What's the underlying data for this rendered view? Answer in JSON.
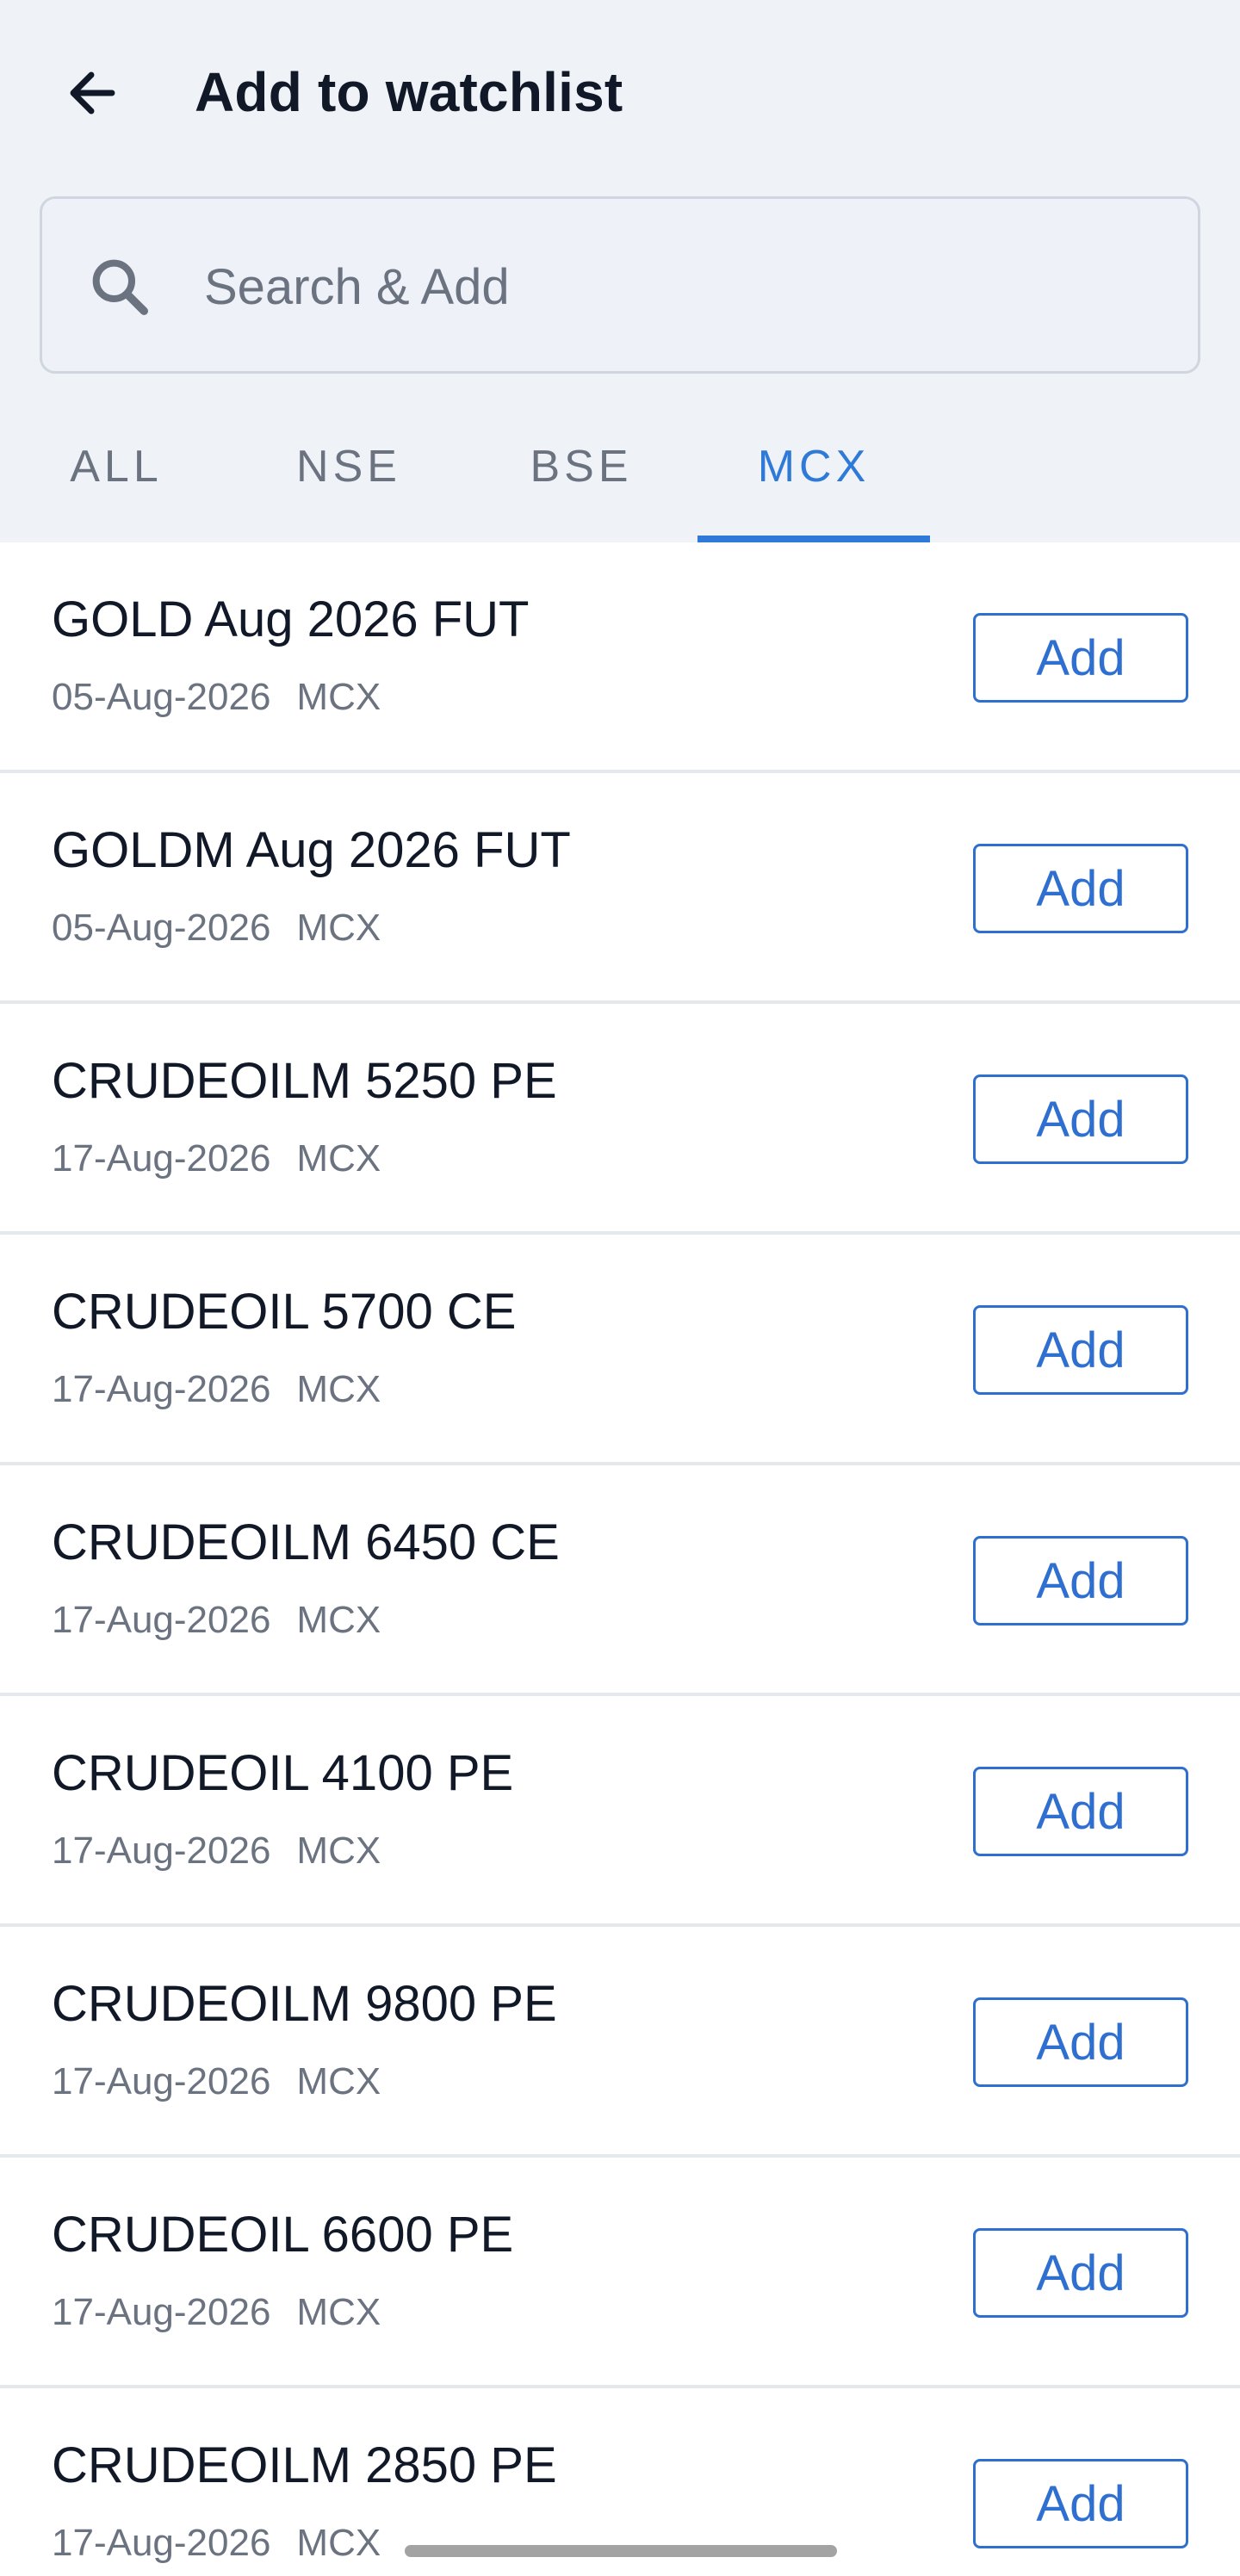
{
  "header": {
    "title": "Add to watchlist",
    "back_icon": "arrow-left-icon"
  },
  "search": {
    "placeholder": "Search & Add",
    "value": "",
    "icon": "search-icon"
  },
  "tabs": [
    {
      "label": "ALL",
      "active": false
    },
    {
      "label": "NSE",
      "active": false
    },
    {
      "label": "BSE",
      "active": false
    },
    {
      "label": "MCX",
      "active": true
    }
  ],
  "colors": {
    "accent": "#2f7ad8",
    "header_bg": "#eff3f8",
    "text_primary": "#111827",
    "text_secondary": "#6b7280"
  },
  "items": [
    {
      "name": "GOLD Aug 2026 FUT",
      "date": "05-Aug-2026",
      "exchange": "MCX",
      "action": "Add"
    },
    {
      "name": "GOLDM Aug 2026 FUT",
      "date": "05-Aug-2026",
      "exchange": "MCX",
      "action": "Add"
    },
    {
      "name": "CRUDEOILM 5250 PE",
      "date": "17-Aug-2026",
      "exchange": "MCX",
      "action": "Add"
    },
    {
      "name": "CRUDEOIL 5700 CE",
      "date": "17-Aug-2026",
      "exchange": "MCX",
      "action": "Add"
    },
    {
      "name": "CRUDEOILM 6450 CE",
      "date": "17-Aug-2026",
      "exchange": "MCX",
      "action": "Add"
    },
    {
      "name": "CRUDEOIL 4100 PE",
      "date": "17-Aug-2026",
      "exchange": "MCX",
      "action": "Add"
    },
    {
      "name": "CRUDEOILM 9800 PE",
      "date": "17-Aug-2026",
      "exchange": "MCX",
      "action": "Add"
    },
    {
      "name": "CRUDEOIL 6600 PE",
      "date": "17-Aug-2026",
      "exchange": "MCX",
      "action": "Add"
    },
    {
      "name": "CRUDEOILM 2850 PE",
      "date": "17-Aug-2026",
      "exchange": "MCX",
      "action": "Add"
    }
  ]
}
